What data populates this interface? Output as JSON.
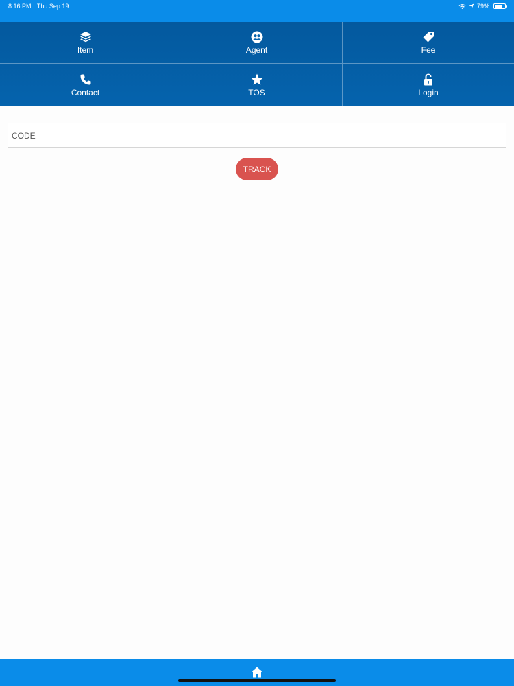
{
  "status_bar": {
    "time": "8:16 PM",
    "date": "Thu Sep 19",
    "battery": "79%",
    "battery_level": 0.79,
    "icons": [
      "signal-icon",
      "wifi-icon",
      "location-icon",
      "battery-icon"
    ]
  },
  "nav": {
    "items": [
      {
        "label": "Item",
        "icon": "layers-icon"
      },
      {
        "label": "Agent",
        "icon": "agent-icon"
      },
      {
        "label": "Fee",
        "icon": "tag-icon"
      },
      {
        "label": "Contact",
        "icon": "phone-icon"
      },
      {
        "label": "TOS",
        "icon": "star-icon"
      },
      {
        "label": "Login",
        "icon": "unlock-icon"
      }
    ]
  },
  "tracking": {
    "code_placeholder": "CODE",
    "code_value": "",
    "track_label": "TRACK"
  },
  "bottom_bar": {
    "home_icon": "home-icon"
  },
  "colors": {
    "status_bar": "#0a8ce9",
    "nav_background": "#0563ad",
    "track_button": "#d9534f",
    "page_background": "#fdfdfd"
  }
}
